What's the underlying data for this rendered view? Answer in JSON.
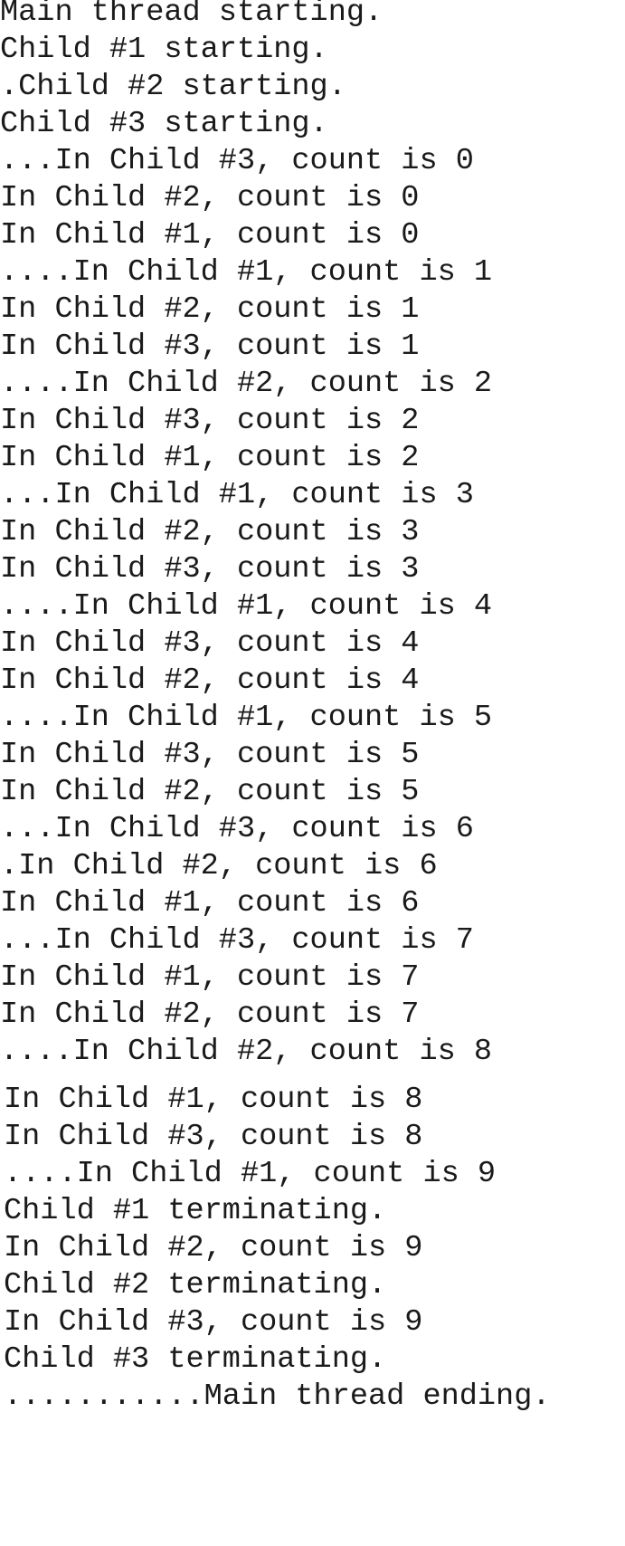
{
  "console": {
    "lines": [
      "Main thread starting.",
      "Child #1 starting.",
      ".Child #2 starting.",
      "Child #3 starting.",
      "...In Child #3, count is 0",
      "In Child #2, count is 0",
      "In Child #1, count is 0",
      "....In Child #1, count is 1",
      "In Child #2, count is 1",
      "In Child #3, count is 1",
      "....In Child #2, count is 2",
      "In Child #3, count is 2",
      "In Child #1, count is 2",
      "...In Child #1, count is 3",
      "In Child #2, count is 3",
      "In Child #3, count is 3",
      "....In Child #1, count is 4",
      "In Child #3, count is 4",
      "In Child #2, count is 4",
      "....In Child #1, count is 5",
      "In Child #3, count is 5",
      "In Child #2, count is 5",
      "...In Child #3, count is 6",
      ".In Child #2, count is 6",
      "In Child #1, count is 6",
      "...In Child #3, count is 7",
      "In Child #1, count is 7",
      "In Child #2, count is 7",
      "....In Child #2, count is 8",
      "In Child #1, count is 8",
      "In Child #3, count is 8",
      "....In Child #1, count is 9",
      "Child #1 terminating.",
      "In Child #2, count is 9",
      "Child #2 terminating.",
      "In Child #3, count is 9",
      "Child #3 terminating.",
      "...........Main thread ending."
    ]
  }
}
